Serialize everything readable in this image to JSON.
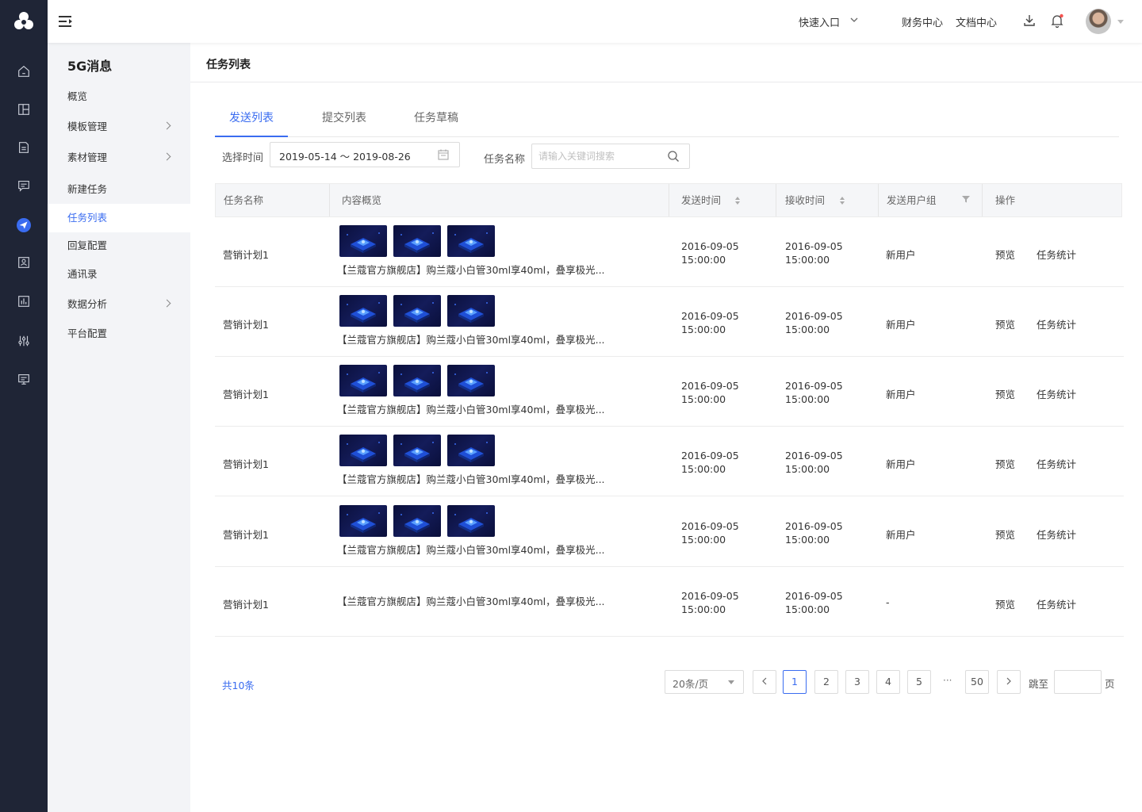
{
  "header": {
    "quick_entry": "快速入口",
    "finance": "财务中心",
    "docs": "文档中心"
  },
  "sidebar": {
    "title": "5G消息",
    "items": [
      {
        "label": "概览",
        "has_children": false,
        "active": false
      },
      {
        "label": "模板管理",
        "has_children": true,
        "active": false
      },
      {
        "label": "素材管理",
        "has_children": true,
        "active": false
      },
      {
        "label": "新建任务",
        "has_children": false,
        "active": false
      },
      {
        "label": "任务列表",
        "has_children": false,
        "active": true
      },
      {
        "label": "回复配置",
        "has_children": false,
        "active": false
      },
      {
        "label": "通讯录",
        "has_children": false,
        "active": false
      },
      {
        "label": "数据分析",
        "has_children": true,
        "active": false
      },
      {
        "label": "平台配置",
        "has_children": false,
        "active": false
      }
    ]
  },
  "rail": {
    "icons": [
      "home-icon",
      "layout-icon",
      "document-icon",
      "message-icon",
      "send-icon",
      "contact-card-icon",
      "bar-chart-icon",
      "sliders-icon",
      "monitor-icon"
    ],
    "active_index": 4
  },
  "page": {
    "title": "任务列表",
    "tabs": [
      "发送列表",
      "提交列表",
      "任务草稿"
    ],
    "active_tab": 0
  },
  "filters": {
    "time_label": "选择时间",
    "date_range": "2019-05-14 ～ 2019-08-26",
    "name_label": "任务名称",
    "search_placeholder": "请输入关键词搜索"
  },
  "table": {
    "columns": [
      "任务名称",
      "内容概览",
      "发送时间",
      "接收时间",
      "发送用户组",
      "操作"
    ],
    "rows": [
      {
        "name": "营销计划1",
        "has_images": true,
        "preview": "【兰蔻官方旗舰店】购兰蔻小白管30ml享40ml，叠享极光...",
        "send_date": "2016-09-05",
        "send_time": "15:00:00",
        "recv_date": "2016-09-05",
        "recv_time": "15:00:00",
        "group": "新用户",
        "op1": "预览",
        "op2": "任务统计"
      },
      {
        "name": "营销计划1",
        "has_images": true,
        "preview": "【兰蔻官方旗舰店】购兰蔻小白管30ml享40ml，叠享极光...",
        "send_date": "2016-09-05",
        "send_time": "15:00:00",
        "recv_date": "2016-09-05",
        "recv_time": "15:00:00",
        "group": "新用户",
        "op1": "预览",
        "op2": "任务统计"
      },
      {
        "name": "营销计划1",
        "has_images": true,
        "preview": "【兰蔻官方旗舰店】购兰蔻小白管30ml享40ml，叠享极光...",
        "send_date": "2016-09-05",
        "send_time": "15:00:00",
        "recv_date": "2016-09-05",
        "recv_time": "15:00:00",
        "group": "新用户",
        "op1": "预览",
        "op2": "任务统计"
      },
      {
        "name": "营销计划1",
        "has_images": true,
        "preview": "【兰蔻官方旗舰店】购兰蔻小白管30ml享40ml，叠享极光...",
        "send_date": "2016-09-05",
        "send_time": "15:00:00",
        "recv_date": "2016-09-05",
        "recv_time": "15:00:00",
        "group": "新用户",
        "op1": "预览",
        "op2": "任务统计"
      },
      {
        "name": "营销计划1",
        "has_images": true,
        "preview": "【兰蔻官方旗舰店】购兰蔻小白管30ml享40ml，叠享极光...",
        "send_date": "2016-09-05",
        "send_time": "15:00:00",
        "recv_date": "2016-09-05",
        "recv_time": "15:00:00",
        "group": "新用户",
        "op1": "预览",
        "op2": "任务统计"
      },
      {
        "name": "营销计划1",
        "has_images": false,
        "preview": "【兰蔻官方旗舰店】购兰蔻小白管30ml享40ml，叠享极光...",
        "send_date": "2016-09-05",
        "send_time": "15:00:00",
        "recv_date": "2016-09-05",
        "recv_time": "15:00:00",
        "group": "-",
        "op1": "预览",
        "op2": "任务统计"
      }
    ]
  },
  "pagination": {
    "total": "共10条",
    "page_size": "20条/页",
    "pages": [
      "1",
      "2",
      "3",
      "4",
      "5"
    ],
    "ellipsis": "···",
    "last": "50",
    "current": "1",
    "jump_label": "跳至",
    "page_unit": "页"
  },
  "colors": {
    "primary": "#3a6cf0",
    "rail_bg": "#1f2536",
    "sidebar_bg": "#f3f4f7",
    "notification_dot": "#f5534f"
  }
}
